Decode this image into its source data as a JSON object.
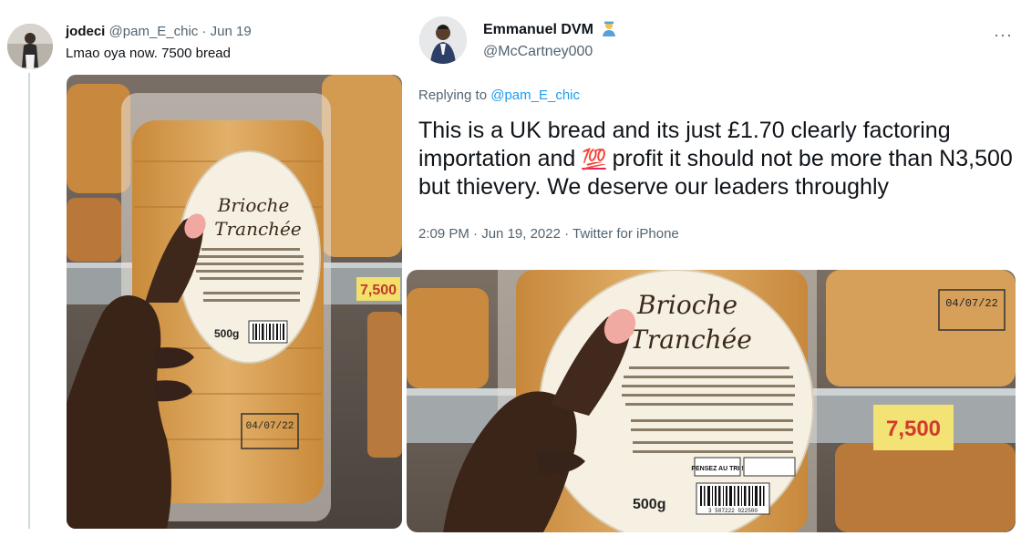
{
  "left_tweet": {
    "name": "jodeci",
    "handle": "@pam_E_chic",
    "dot": "·",
    "date": "Jun 19",
    "text": "Lmao oya now. 7500 bread",
    "photo": {
      "brand_line1": "Brioche",
      "brand_line2": "Tranchée",
      "weight": "500g",
      "price_tag": "7,500",
      "date_code": "04/07/22"
    }
  },
  "right_tweet": {
    "name": "Emmanuel DVM",
    "name_emoji": "health-worker-emoji",
    "handle": "@McCartney000",
    "more_label": "···",
    "replying_prefix": "Replying to",
    "replying_handle": "@pam_E_chic",
    "text_part1": "This is a UK bread and its just £1.70 clearly factoring importation and",
    "text_emoji": "💯",
    "text_part2": "profit it should not be more than N3,500 but thievery. We deserve our leaders throughly",
    "time": "2:09 PM",
    "date": "Jun 19, 2022",
    "source": "Twitter for iPhone",
    "photo": {
      "brand_line1": "Brioche",
      "brand_line2": "Tranchée",
      "weight": "500g",
      "price_tag": "7,500",
      "date_code": "04/07/22",
      "recycle_label": "PENSEZ AU TRI !",
      "barcode_number": "3 587222 022500"
    }
  }
}
